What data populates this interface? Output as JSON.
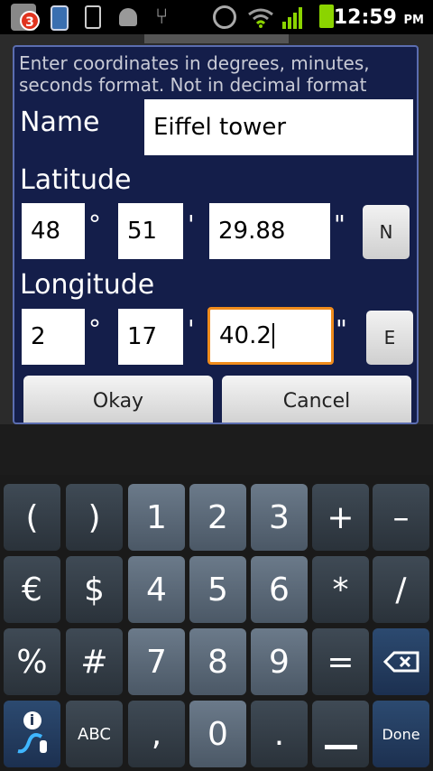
{
  "status_bar": {
    "notification_count": "3",
    "time": "12:59",
    "ampm": "PM",
    "icons": [
      "notification-badge",
      "phone-icon",
      "phone-icon",
      "android-icon",
      "usb-icon",
      "gps-icon",
      "wifi-icon",
      "signal-icon",
      "battery-icon"
    ]
  },
  "dialog": {
    "hint": "Enter coordinates in degrees, minutes, seconds format. Not in decimal format",
    "name_label": "Name",
    "name_value": "Eiffel tower",
    "latitude_label": "Latitude",
    "latitude": {
      "deg": "48",
      "min": "51",
      "sec": "29.88",
      "dir": "N"
    },
    "longitude_label": "Longitude",
    "longitude": {
      "deg": "2",
      "min": "17",
      "sec": "40.2",
      "dir": "E"
    },
    "degree_symbol": "°",
    "minute_symbol": "'",
    "second_symbol": "\"",
    "okay_label": "Okay",
    "cancel_label": "Cancel"
  },
  "keyboard": {
    "row1": [
      "(",
      ")",
      "1",
      "2",
      "3",
      "+",
      "–"
    ],
    "row2": [
      "€",
      "$",
      "4",
      "5",
      "6",
      "*",
      "/"
    ],
    "row3": [
      "%",
      "#",
      "7",
      "8",
      "9",
      "="
    ],
    "row4": [
      "ABC",
      ",",
      "0",
      ".",
      "Done"
    ],
    "info_symbol": "i"
  }
}
